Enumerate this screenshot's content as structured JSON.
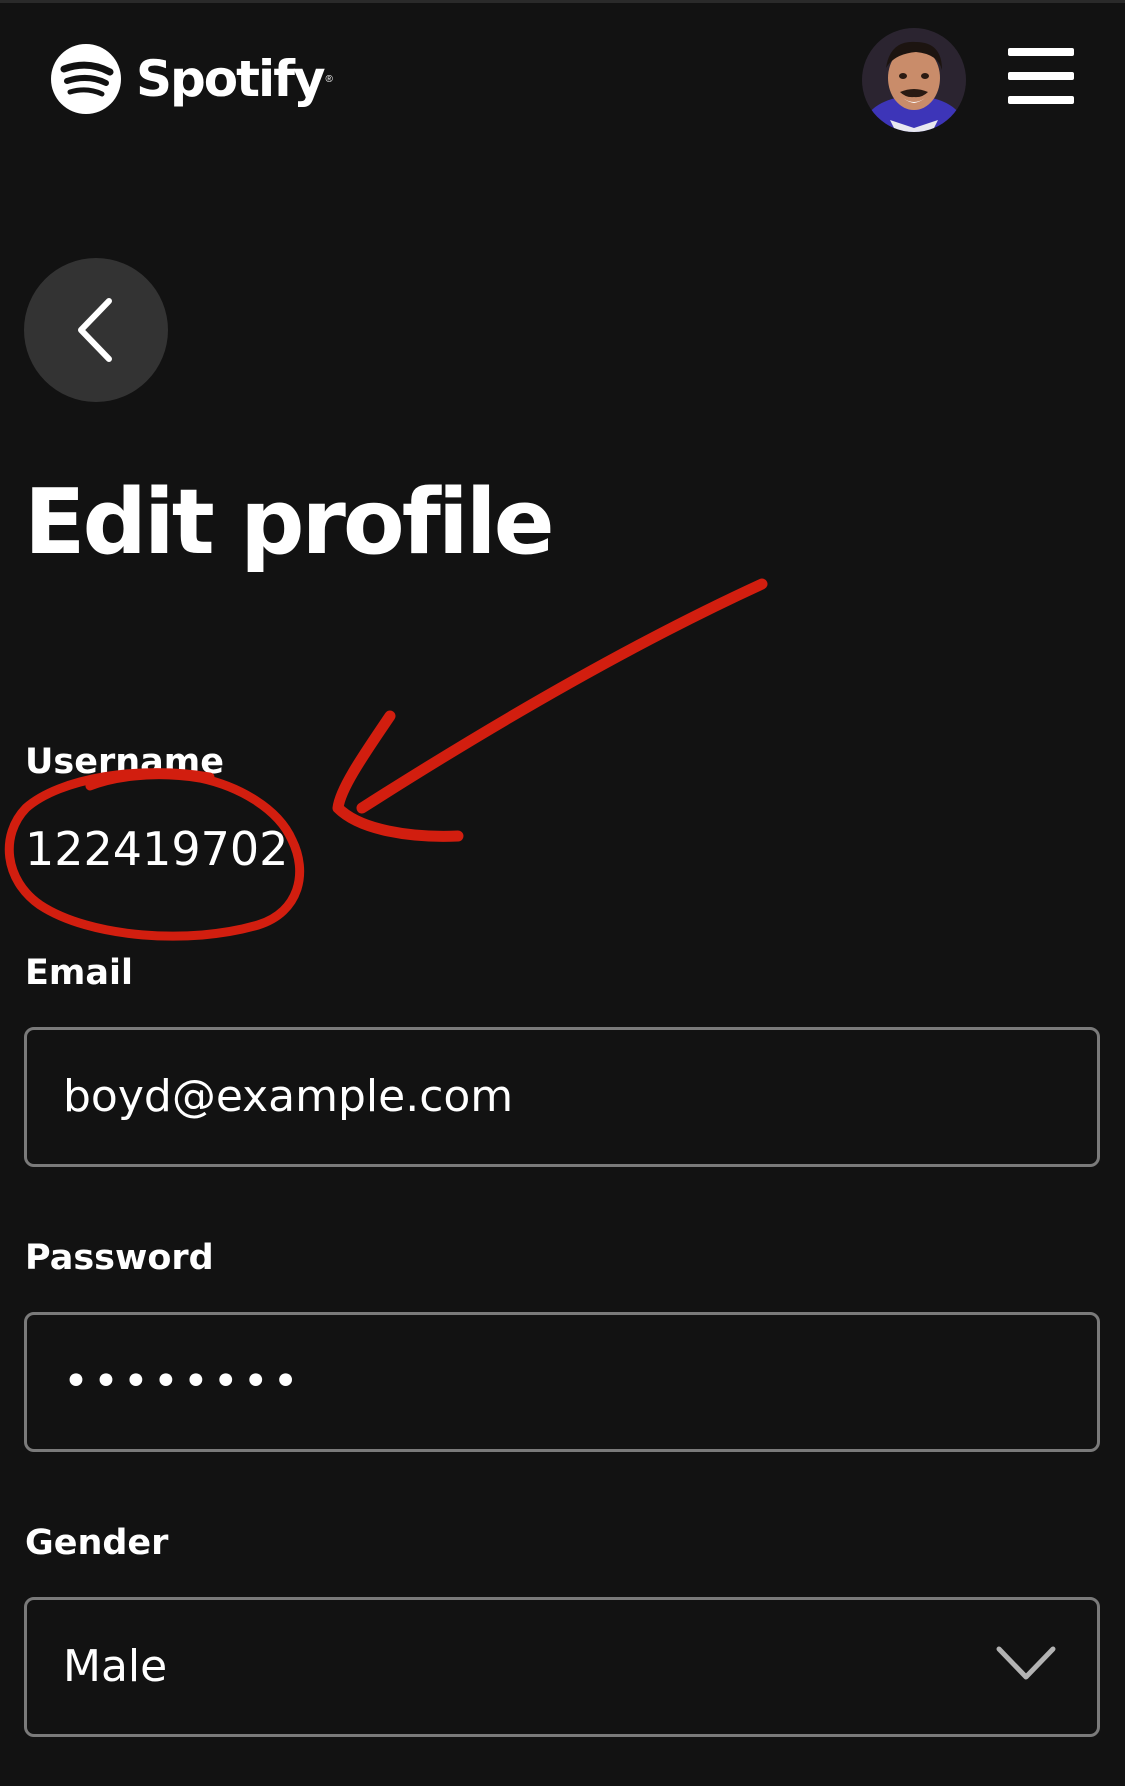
{
  "header": {
    "brand_name": "Spotify",
    "brand_reg_mark": "®",
    "logo_icon": "spotify-logo-icon",
    "avatar_icon": "user-avatar",
    "menu_icon": "hamburger-menu-icon"
  },
  "navigation": {
    "back_icon": "chevron-left-icon"
  },
  "page": {
    "title": "Edit profile"
  },
  "form": {
    "username": {
      "label": "Username",
      "value": "122419702"
    },
    "email": {
      "label": "Email",
      "value": "boyd@example.com"
    },
    "password": {
      "label": "Password",
      "value": "••••••••"
    },
    "gender": {
      "label": "Gender",
      "value": "Male",
      "icon": "chevron-down-icon"
    }
  },
  "annotation": {
    "color": "#d21e0f",
    "shapes": [
      "circle-around-username",
      "arrow-pointing-to-username"
    ]
  },
  "colors": {
    "background": "#121212",
    "text": "#ffffff",
    "field_border": "#7a7a7a",
    "back_button_bg": "#333333"
  }
}
